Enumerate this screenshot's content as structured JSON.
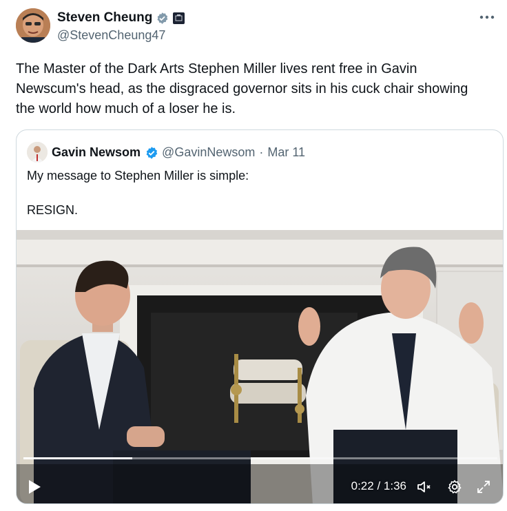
{
  "tweet": {
    "author_name": "Steven Cheung",
    "author_handle": "@StevenCheung47",
    "text": "The Master of the Dark Arts Stephen Miller lives rent free in Gavin Newscum's head, as the disgraced governor sits in his cuck chair showing the world how much of a loser he is.",
    "more_icon": "more-horizontal-icon"
  },
  "quote": {
    "author_name": "Gavin Newsom",
    "author_handle": "@GavinNewsom",
    "separator": "·",
    "date": "Mar 11",
    "line1": "My message to Stephen Miller is simple:",
    "line2": "RESIGN."
  },
  "video": {
    "current_time": "0:22",
    "time_separator": "/",
    "duration": "1:36",
    "progress_fraction": 0.229,
    "icons": [
      "play-icon",
      "mute-icon",
      "settings-gear-icon",
      "fullscreen-icon"
    ]
  },
  "colors": {
    "verified_blue": "#1d9bf0",
    "verified_gray": "#829aab",
    "secondary_text": "#536471",
    "border": "#cfd9de"
  }
}
